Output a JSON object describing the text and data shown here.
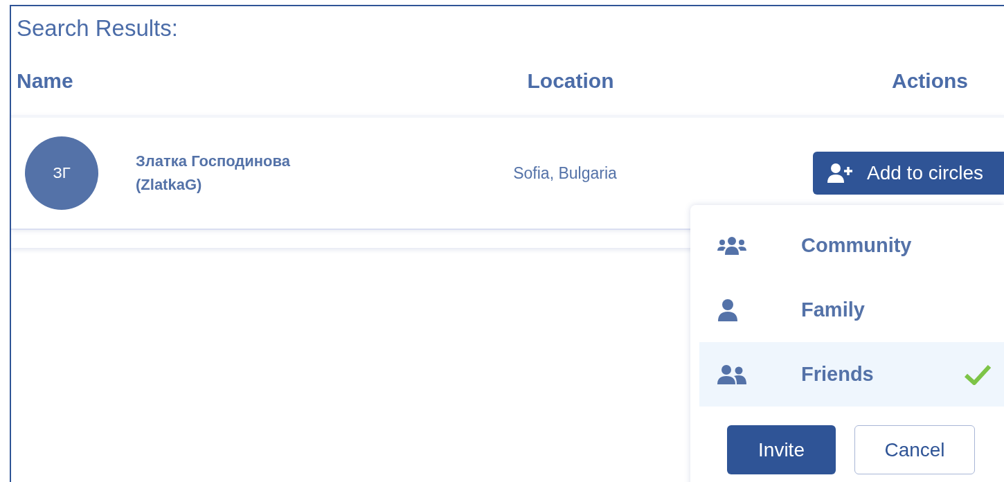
{
  "title": "Search Results:",
  "columns": [
    "Name",
    "Location",
    "Actions"
  ],
  "rows": [
    {
      "initials": "ЗГ",
      "name": "Златка Господинова",
      "username": "(ZlatkaG)",
      "location": "Sofia, Bulgaria",
      "action": "Add to circles"
    }
  ],
  "circles_menu": {
    "items": [
      {
        "label": "Community",
        "kind": "community",
        "selected": false
      },
      {
        "label": "Family",
        "kind": "family",
        "selected": false
      },
      {
        "label": "Friends",
        "kind": "friends",
        "selected": true
      }
    ],
    "buttons": [
      {
        "label": "Invite",
        "kind": "primary"
      },
      {
        "label": "Cancel",
        "kind": "secondary"
      }
    ]
  }
}
